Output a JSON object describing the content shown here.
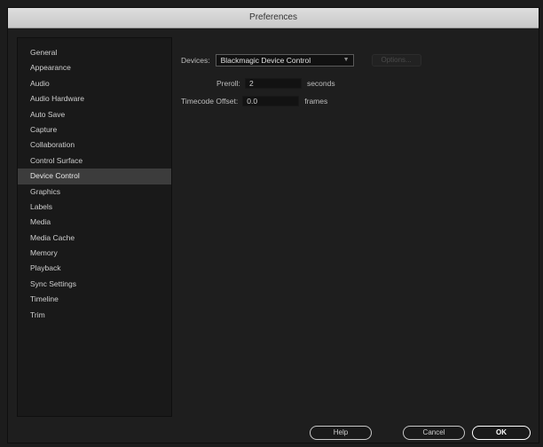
{
  "window": {
    "title": "Preferences"
  },
  "sidebar": {
    "selected_index": 8,
    "items": [
      {
        "label": "General"
      },
      {
        "label": "Appearance"
      },
      {
        "label": "Audio"
      },
      {
        "label": "Audio Hardware"
      },
      {
        "label": "Auto Save"
      },
      {
        "label": "Capture"
      },
      {
        "label": "Collaboration"
      },
      {
        "label": "Control Surface"
      },
      {
        "label": "Device Control"
      },
      {
        "label": "Graphics"
      },
      {
        "label": "Labels"
      },
      {
        "label": "Media"
      },
      {
        "label": "Media Cache"
      },
      {
        "label": "Memory"
      },
      {
        "label": "Playback"
      },
      {
        "label": "Sync Settings"
      },
      {
        "label": "Timeline"
      },
      {
        "label": "Trim"
      }
    ]
  },
  "device_control": {
    "devices_label": "Devices:",
    "devices_value": "Blackmagic Device Control",
    "options_label": "Options...",
    "preroll_label": "Preroll:",
    "preroll_value": "2",
    "preroll_unit": "seconds",
    "timecode_offset_label": "Timecode Offset:",
    "timecode_offset_value": "0.0",
    "timecode_offset_unit": "frames"
  },
  "footer": {
    "help_label": "Help",
    "cancel_label": "Cancel",
    "ok_label": "OK"
  }
}
